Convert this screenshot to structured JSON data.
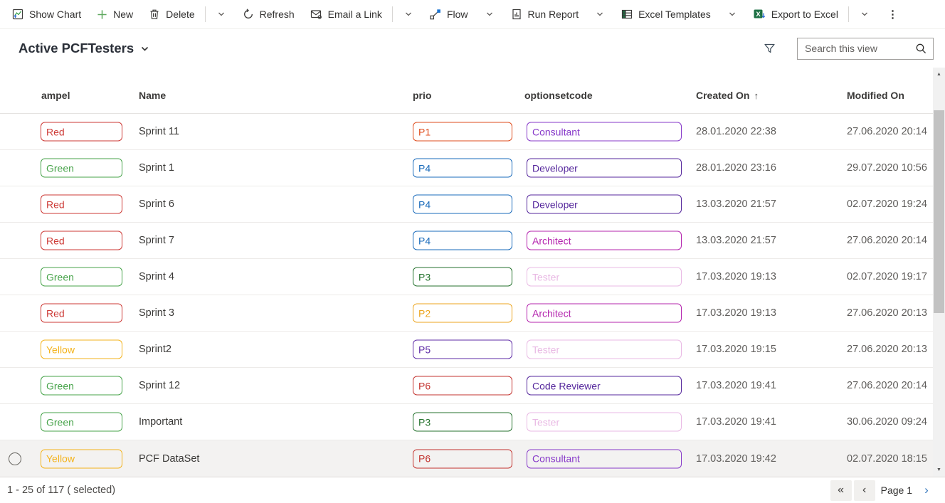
{
  "toolbar": {
    "items": [
      {
        "label": "Show Chart"
      },
      {
        "label": "New"
      },
      {
        "label": "Delete"
      },
      {
        "label": "Refresh"
      },
      {
        "label": "Email a Link"
      },
      {
        "label": "Flow"
      },
      {
        "label": "Run Report"
      },
      {
        "label": "Excel Templates"
      },
      {
        "label": "Export to Excel"
      }
    ]
  },
  "view": {
    "title": "Active PCFTesters",
    "search_placeholder": "Search this view"
  },
  "grid": {
    "columns": [
      {
        "label": "ampel"
      },
      {
        "label": "Name"
      },
      {
        "label": "prio"
      },
      {
        "label": "optionsetcode"
      },
      {
        "label": "Created On",
        "sorted": "ascending"
      },
      {
        "label": "Modified On"
      }
    ],
    "rows": [
      {
        "ampel": {
          "label": "Red",
          "color": "#cd3a36"
        },
        "name": "Sprint 11",
        "prio": {
          "label": "P1",
          "color": "#df4d1e"
        },
        "optionset": {
          "label": "Consultant",
          "color": "#8739c9"
        },
        "created": "28.01.2020 22:38",
        "modified": "27.06.2020 20:14"
      },
      {
        "ampel": {
          "label": "Green",
          "color": "#47a34a"
        },
        "name": "Sprint 1",
        "prio": {
          "label": "P4",
          "color": "#1a6bbb"
        },
        "optionset": {
          "label": "Developer",
          "color": "#55279c"
        },
        "created": "28.01.2020 23:16",
        "modified": "29.07.2020 10:56"
      },
      {
        "ampel": {
          "label": "Red",
          "color": "#cd3a36"
        },
        "name": "Sprint 6",
        "prio": {
          "label": "P4",
          "color": "#1a6bbb"
        },
        "optionset": {
          "label": "Developer",
          "color": "#55279c"
        },
        "created": "13.03.2020 21:57",
        "modified": "02.07.2020 19:24"
      },
      {
        "ampel": {
          "label": "Red",
          "color": "#cd3a36"
        },
        "name": "Sprint 7",
        "prio": {
          "label": "P4",
          "color": "#1a6bbb"
        },
        "optionset": {
          "label": "Architect",
          "color": "#b424ae"
        },
        "created": "13.03.2020 21:57",
        "modified": "27.06.2020 20:14"
      },
      {
        "ampel": {
          "label": "Green",
          "color": "#47a34a"
        },
        "name": "Sprint 4",
        "prio": {
          "label": "P3",
          "color": "#24722d"
        },
        "optionset": {
          "label": "Tester",
          "color": "#e9b9e4"
        },
        "created": "17.03.2020 19:13",
        "modified": "02.07.2020 19:17"
      },
      {
        "ampel": {
          "label": "Red",
          "color": "#cd3a36"
        },
        "name": "Sprint 3",
        "prio": {
          "label": "P2",
          "color": "#eca51f"
        },
        "optionset": {
          "label": "Architect",
          "color": "#b424ae"
        },
        "created": "17.03.2020 19:13",
        "modified": "27.06.2020 20:13"
      },
      {
        "ampel": {
          "label": "Yellow",
          "color": "#f3b31c"
        },
        "name": "Sprint2",
        "prio": {
          "label": "P5",
          "color": "#5e2ba6"
        },
        "optionset": {
          "label": "Tester",
          "color": "#e9b9e4"
        },
        "created": "17.03.2020 19:15",
        "modified": "27.06.2020 20:13"
      },
      {
        "ampel": {
          "label": "Green",
          "color": "#47a34a"
        },
        "name": "Sprint 12",
        "prio": {
          "label": "P6",
          "color": "#c3332f"
        },
        "optionset": {
          "label": "Code Reviewer",
          "color": "#55279c"
        },
        "created": "17.03.2020 19:41",
        "modified": "27.06.2020 20:14"
      },
      {
        "ampel": {
          "label": "Green",
          "color": "#47a34a"
        },
        "name": "Important",
        "prio": {
          "label": "P3",
          "color": "#24722d"
        },
        "optionset": {
          "label": "Tester",
          "color": "#e9b9e4"
        },
        "created": "17.03.2020 19:41",
        "modified": "30.06.2020 09:24"
      },
      {
        "ampel": {
          "label": "Yellow",
          "color": "#f3b31c"
        },
        "name": "PCF DataSet",
        "prio": {
          "label": "P6",
          "color": "#c3332f"
        },
        "optionset": {
          "label": "Consultant",
          "color": "#8739c9"
        },
        "created": "17.03.2020 19:42",
        "modified": "02.07.2020 18:15",
        "highlighted": true
      }
    ]
  },
  "footer": {
    "status": "1 - 25 of 117 ( selected)",
    "page_label": "Page 1"
  },
  "icons": {
    "ellipsis": "⋮",
    "sort_asc": "↑",
    "page_first": "«",
    "page_prev": "‹",
    "page_next": "›",
    "scroll_up": "▲",
    "scroll_down": "▼"
  },
  "colors": {
    "excel_green": "#1e7145",
    "flow_blue": "#1b74d2",
    "new_plus_green": "#5fa85f",
    "chart_line_green": "#2f9e44",
    "chart_arrow_blue": "#2b6bd8",
    "row_highlight": "#f3f2f1",
    "date_text": "#5f5d5b",
    "scrollbar_thumb": "#c2c2c2"
  }
}
